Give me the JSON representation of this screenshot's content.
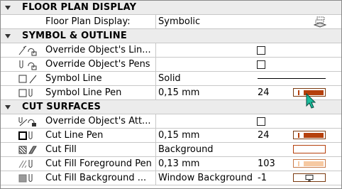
{
  "floor_plan": {
    "title": "FLOOR PLAN DISPLAY",
    "display_label": "Floor Plan Display:",
    "display_value": "Symbolic",
    "icon": "floor-plan-layers-icon"
  },
  "symbol": {
    "title": "SYMBOL & OUTLINE",
    "rows": [
      {
        "name": "Override Object's Lin...",
        "icon": "override-lines-icon",
        "checked": false
      },
      {
        "name": "Override Object's Pens",
        "icon": "override-pens-icon",
        "checked": false
      },
      {
        "name": "Symbol Line",
        "value": "Solid",
        "icon": "symbol-line-icon"
      },
      {
        "name": "Symbol Line Pen",
        "value": "0,15 mm",
        "pen": "24",
        "icon": "symbol-line-pen-icon",
        "swatch_color": "#b5400c"
      }
    ]
  },
  "cut": {
    "title": "CUT SURFACES",
    "rows": [
      {
        "name": "Override Object's Att...",
        "icon": "override-attributes-icon",
        "checked": false
      },
      {
        "name": "Cut Line Pen",
        "value": "0,15 mm",
        "pen": "24",
        "icon": "cut-line-pen-icon",
        "swatch_color": "#b5400c"
      },
      {
        "name": "Cut Fill",
        "value": "Background",
        "icon": "cut-fill-icon",
        "swatch_color": "#ffffff"
      },
      {
        "name": "Cut Fill Foreground Pen",
        "value": "0,13 mm",
        "pen": "103",
        "icon": "cut-fill-foreground-pen-icon",
        "swatch_color": "#f6c9a2"
      },
      {
        "name": "Cut Fill Background ...",
        "value": "Window Background",
        "pen": "-1",
        "icon": "cut-fill-background-pen-icon",
        "swatch_icon": "monitor-icon"
      }
    ]
  },
  "colors": {
    "section_bg": "#ececec",
    "pen_brown": "#b5400c",
    "cursor_teal": "#1abc9c"
  }
}
